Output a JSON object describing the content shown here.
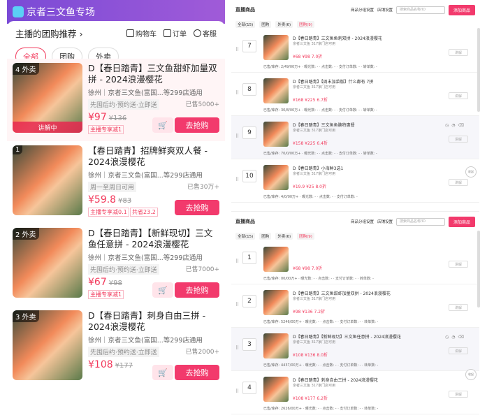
{
  "left": {
    "header_title": "京者三文鱼专场",
    "panel_title": "主播的团购推荐 ›",
    "actions": {
      "cart": "购物车",
      "orders": "订单",
      "service": "客服"
    },
    "tabs": [
      "全部",
      "团购",
      "外卖"
    ],
    "products": [
      {
        "num": "4 外卖",
        "name": "D【春日踏青】三文鱼甜虾加量双拼 - 2024浪漫樱花",
        "shop": "徐州｜京者三文鱼(富国...等299店通用",
        "tag": "先囤后约·预约送·立即送",
        "sold": "已售5000+",
        "price": "¥97",
        "orig": "¥136",
        "promo": "主播专享减1",
        "promo2": "",
        "live": "讲解中",
        "buy": "去抢购"
      },
      {
        "num": "1",
        "name": "【春日踏青】招牌鲜爽双人餐 - 2024浪漫樱花",
        "shop": "徐州｜京者三文鱼(富国...等299店通用",
        "tag": "周一至周日可用",
        "sold": "已售30万+",
        "price": "¥59.8",
        "orig": "¥83",
        "promo": "主播专享减0.1",
        "promo2": "共省23.2",
        "live": "",
        "buy": "去抢购"
      },
      {
        "num": "2 外卖",
        "name": "D【春日踏青】【新鲜现切】三文鱼任意拼 - 2024浪漫樱花",
        "shop": "徐州｜京者三文鱼(富国...等299店通用",
        "tag": "先囤后约·预约送·立即送",
        "sold": "已售7000+",
        "price": "¥67",
        "orig": "¥98",
        "promo": "主播专享减1",
        "promo2": "",
        "live": "",
        "buy": "去抢购"
      },
      {
        "num": "3 外卖",
        "name": "D【春日踏青】刺身自由三拼 - 2024浪漫樱花",
        "shop": "徐州｜京者三文鱼(富国...等299店通用",
        "tag": "先囤后约·预约送·立即送",
        "sold": "已售2000+",
        "price": "¥108",
        "orig": "¥177",
        "promo": "",
        "promo2": "",
        "live": "",
        "buy": "去抢购"
      }
    ]
  },
  "right_top": {
    "title": "直播商品",
    "tools": [
      "商品分组设置",
      "店铺设置"
    ],
    "search_placeholder": "搜索商品名称/ID",
    "add": "添加商品",
    "tabs": [
      "全部(15)",
      "团购",
      "外卖(6)",
      "团购(9)"
    ],
    "rows": [
      {
        "n": "7",
        "name": "D【春日踏青】三文鱼鱼刺双拼 - 2024浪漫樱花",
        "shop": "京者三文鱼 317家门店可用",
        "price": "¥68 ¥98 7.0折",
        "stats": "已售/库存: 2/49/00万+ · 曝光数: - · 点击数: - · 支付订单数: - · 转单数: -",
        "btn": "讲解"
      },
      {
        "n": "8",
        "name": "D【春日踏青】【周末加菜版】什么都有 7拼",
        "shop": "京者三文鱼 317家门店可用",
        "price": "¥168 ¥225 6.7折",
        "stats": "已售/库存: 30/8/00万+ · 曝光数: - · 点击数: - · 支付订单数: - · 转单数: -",
        "btn": "讲解"
      },
      {
        "n": "9",
        "name": "D【春日踏青】三文鱼鱼腩特惠餐",
        "shop": "京者三文鱼 317家门店可用",
        "price": "¥158 ¥225 6.4折",
        "stats": "已售/库存: 70/0/00万+ · 曝光数: - · 点击数: - · 支付订单数: - · 转单数: -",
        "btn": "讲解"
      },
      {
        "n": "10",
        "name": "D【春日踏青】小海鲜3选1",
        "shop": "京者三文鱼 317家门店可用",
        "price": "¥19.9 ¥25 8.0折",
        "stats": "已售/库存: 4/0/00万+ · 曝光数: - · 点击数: - · 支付订单数: -",
        "btn": "讲解"
      }
    ]
  },
  "right_bottom": {
    "title": "直播商品",
    "tools": [
      "商品分组设置",
      "店铺设置"
    ],
    "search_placeholder": "搜索商品名称/ID",
    "add": "添加商品",
    "tabs": [
      "全部(15)",
      "团购",
      "外卖(6)",
      "团购(9)"
    ],
    "rows": [
      {
        "n": "1",
        "name": "",
        "shop": "",
        "price": "¥68 ¥98 7.0折",
        "stats": "已售/库存: 00/00万+ · 曝光数: - · 点击数: - · 支付订单数: - · 转单数: -",
        "btn": "讲解"
      },
      {
        "n": "2",
        "name": "D【春日踏青】三文鱼甜虾加量双拼 - 2024浪漫樱花",
        "shop": "京者三文鱼 317家门店可用",
        "price": "¥98 ¥136 7.2折",
        "stats": "已售/库存: 5246/00万+ · 曝光数: - · 点击数: - · 支付订单数: - · 转单数: -",
        "btn": "讲解"
      },
      {
        "n": "3",
        "name": "D【春日踏青】【新鲜现切】三文鱼任意拼 - 2024浪漫樱花",
        "shop": "京者三文鱼 317家门店可用",
        "price": "¥108 ¥136 8.0折",
        "stats": "已售/库存: 4437/00万+ · 曝光数: - · 点击数: - · 支付订单数: - · 转单数: -",
        "btn": "讲解"
      },
      {
        "n": "4",
        "name": "D【春日踏青】刺身自由三拼 - 2024浪漫樱花",
        "shop": "京者三文鱼 317家门店可用",
        "price": "¥108 ¥177 6.2折",
        "stats": "已售/库存: 2626/00万+ · 曝光数: - · 点击数: - · 支付订单数: - · 转单数: -",
        "btn": "讲解"
      }
    ]
  },
  "side_expand": "收起"
}
